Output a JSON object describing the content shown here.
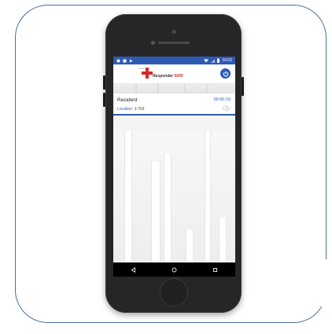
{
  "status_bar": {
    "time": "10:02",
    "left_icons": [
      "notification-icon",
      "square-icon",
      "play-icon"
    ],
    "right_icons": [
      "wifi-icon",
      "signal-icon",
      "battery-icon"
    ]
  },
  "app": {
    "logo_small": "Student",
    "logo_brand": "Responder",
    "logo_number": "5000",
    "power_icon": "power-icon",
    "accent_color": "#2e5ab4",
    "logo_red": "#d62a2a"
  },
  "call": {
    "name": "Resident",
    "timer": "00:00:19",
    "location_label": "Location:",
    "location_value": "1-702",
    "speaker_icon": "speaker-icon"
  },
  "nav": {
    "back_icon": "back-icon",
    "home_icon": "home-icon",
    "recents_icon": "recents-icon"
  }
}
